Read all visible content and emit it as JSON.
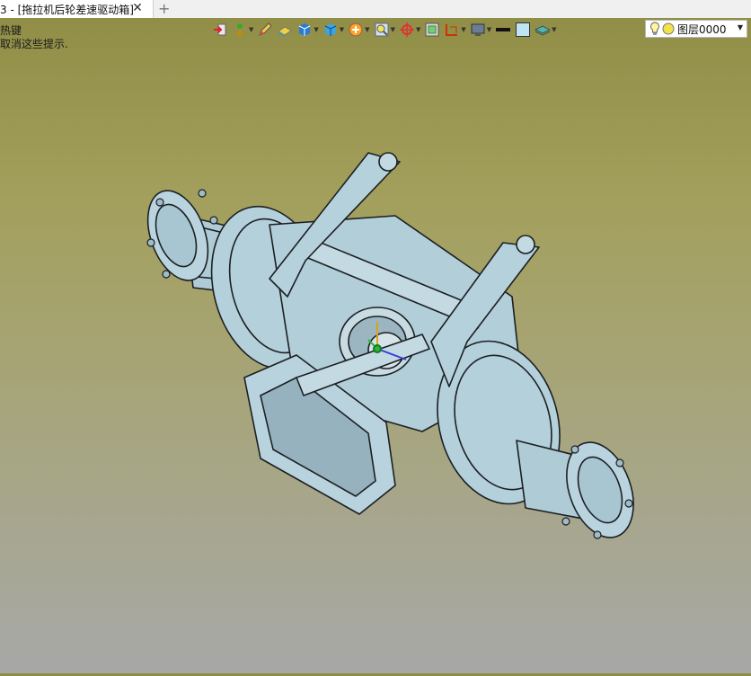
{
  "tab": {
    "title": "3 - [拖拉机后轮差速驱动箱]",
    "close_symbol": "✕",
    "add_symbol": "+"
  },
  "hints": {
    "line1": "热键",
    "line2": "取消这些提示."
  },
  "toolbar": {
    "icons": [
      "import-icon",
      "gravity-icon",
      "pencil-icon",
      "sheet-icon",
      "cube-icon",
      "cube-blue-icon",
      "rotate-icon",
      "zoom-icon",
      "axis-icon",
      "view-icon",
      "dimension-icon",
      "monitor-icon",
      "line-color-icon",
      "fill-color-icon",
      "layers-icon"
    ],
    "layer": {
      "name": "图层0000",
      "bulb": "lightbulb-icon",
      "color": "#f2e14a"
    }
  },
  "colors": {
    "model": "#b7d3dd",
    "outline": "#1c1f22",
    "bg_top": "#8f8c45",
    "bg_bottom": "#a7a8a7"
  }
}
